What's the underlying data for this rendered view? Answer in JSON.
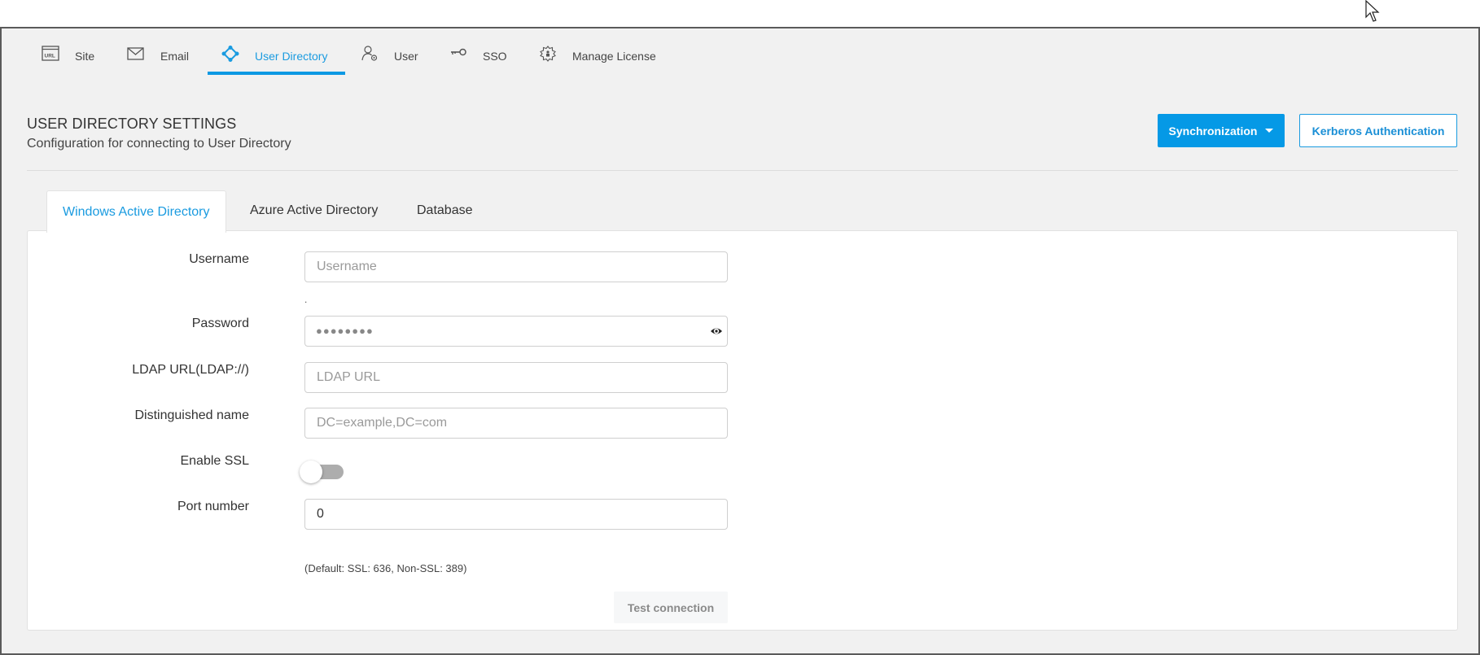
{
  "nav": {
    "items": [
      {
        "label": "Site",
        "icon": "url-window-icon"
      },
      {
        "label": "Email",
        "icon": "envelope-icon"
      },
      {
        "label": "User Directory",
        "icon": "directory-nodes-icon",
        "active": true
      },
      {
        "label": "User",
        "icon": "user-gear-icon"
      },
      {
        "label": "SSO",
        "icon": "key-icon"
      },
      {
        "label": "Manage License",
        "icon": "license-gear-icon"
      }
    ],
    "active_color": "#1a9be0"
  },
  "header": {
    "title": "USER DIRECTORY SETTINGS",
    "subtitle": "Configuration for connecting to User Directory",
    "sync_button": "Synchronization",
    "kerberos_button": "Kerberos Authentication"
  },
  "tabs": [
    {
      "label": "Windows Active Directory",
      "active": true
    },
    {
      "label": "Azure Active Directory"
    },
    {
      "label": "Database"
    }
  ],
  "form": {
    "username": {
      "label": "Username",
      "placeholder": "Username",
      "value": ""
    },
    "username_hint": ".",
    "password": {
      "label": "Password",
      "masked_value": "●●●●●●●●"
    },
    "ldap_url": {
      "label": "LDAP URL(LDAP://)",
      "placeholder": "LDAP URL",
      "value": ""
    },
    "distinguished_name": {
      "label": "Distinguished name",
      "placeholder": "DC=example,DC=com",
      "value": ""
    },
    "enable_ssl": {
      "label": "Enable SSL",
      "checked": false
    },
    "port": {
      "label": "Port number",
      "value": "0",
      "helper": "(Default: SSL: 636, Non-SSL: 389)"
    },
    "test_button": "Test connection"
  },
  "colors": {
    "primary": "#0599e6",
    "background": "#f1f1f1"
  }
}
